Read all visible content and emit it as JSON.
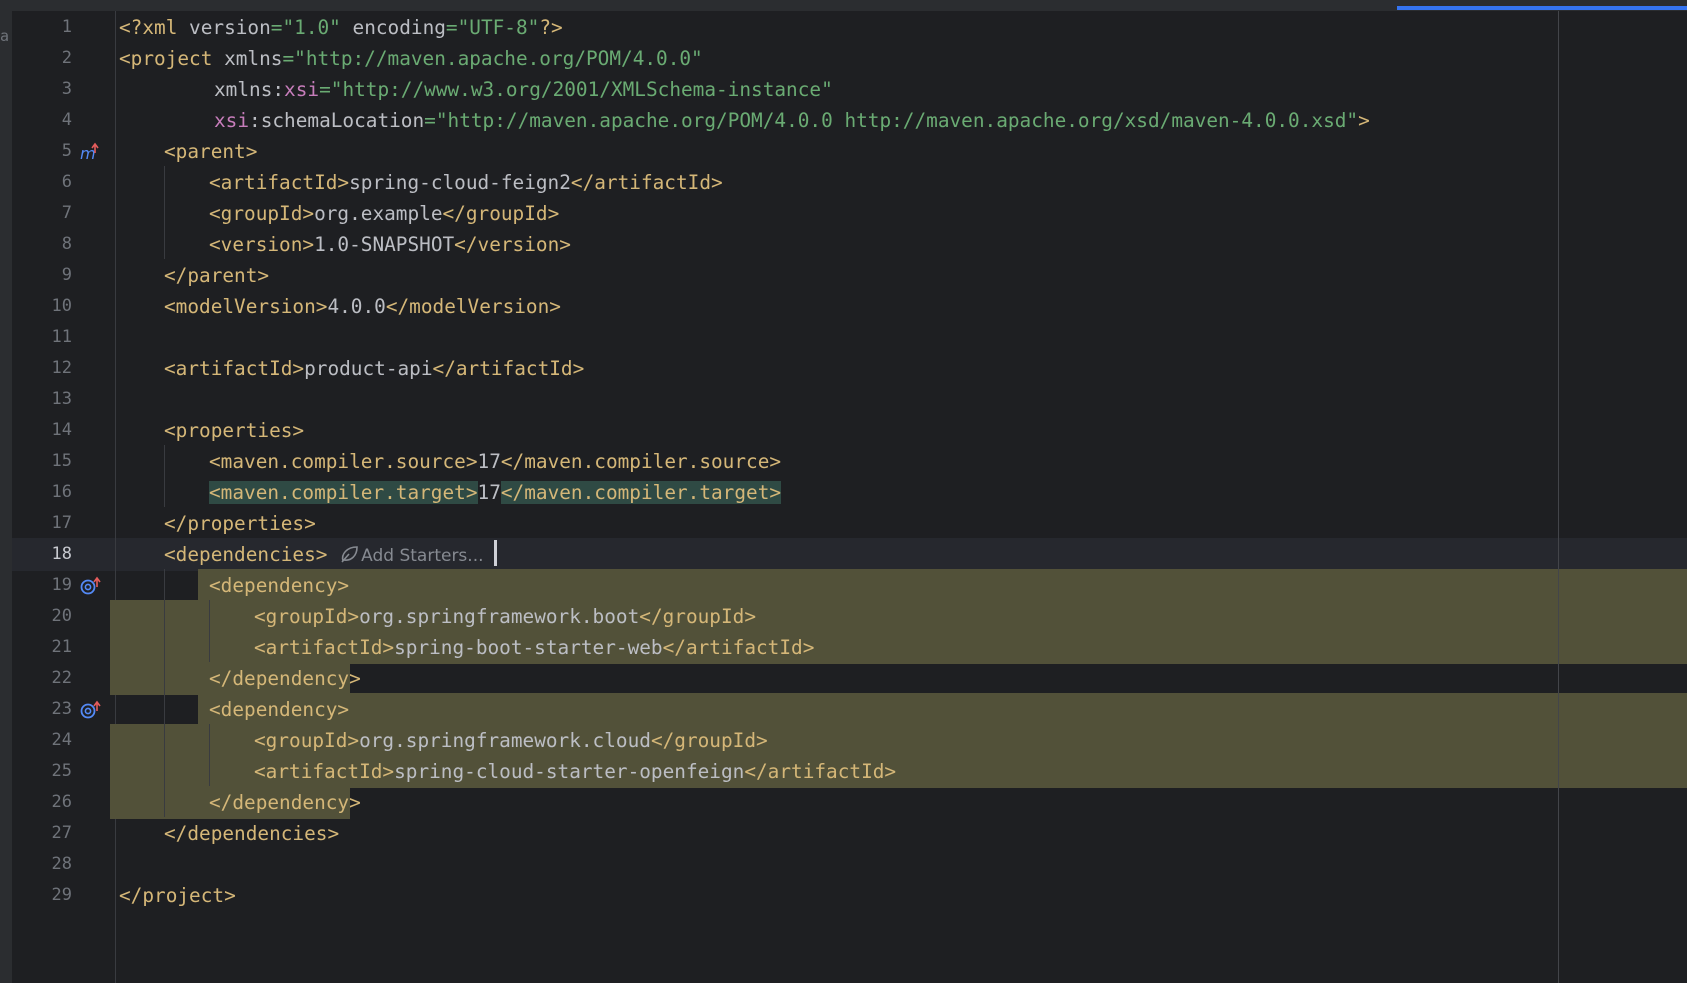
{
  "editor": {
    "left_strip_letter": "a",
    "current_line": 18,
    "lines": [
      {
        "n": "1"
      },
      {
        "n": "2"
      },
      {
        "n": "3"
      },
      {
        "n": "4"
      },
      {
        "n": "5"
      },
      {
        "n": "6"
      },
      {
        "n": "7"
      },
      {
        "n": "8"
      },
      {
        "n": "9"
      },
      {
        "n": "10"
      },
      {
        "n": "11"
      },
      {
        "n": "12"
      },
      {
        "n": "13"
      },
      {
        "n": "14"
      },
      {
        "n": "15"
      },
      {
        "n": "16"
      },
      {
        "n": "17"
      },
      {
        "n": "18"
      },
      {
        "n": "19"
      },
      {
        "n": "20"
      },
      {
        "n": "21"
      },
      {
        "n": "22"
      },
      {
        "n": "23"
      },
      {
        "n": "24"
      },
      {
        "n": "25"
      },
      {
        "n": "26"
      },
      {
        "n": "27"
      },
      {
        "n": "28"
      },
      {
        "n": "29"
      }
    ],
    "code": {
      "l1": {
        "open": "<?xml ",
        "a1": "version",
        "eq1": "=",
        "v1": "\"1.0\"",
        "a2": " encoding",
        "eq2": "=",
        "v2": "\"UTF-8\"",
        "close": "?>"
      },
      "l2": {
        "open": "<project ",
        "a1": "xmlns",
        "eq1": "=",
        "v1": "\"http://maven.apache.org/POM/4.0.0\""
      },
      "l3": {
        "a1": "xmlns:",
        "ns": "xsi",
        "eq1": "=",
        "v1": "\"http://www.w3.org/2001/XMLSchema-instance\""
      },
      "l4": {
        "ns": "xsi",
        "a1": ":schemaLocation",
        "eq1": "=",
        "v1": "\"http://maven.apache.org/POM/4.0.0 http://maven.apache.org/xsd/maven-4.0.0.xsd\"",
        "close": ">"
      },
      "l5": {
        "tag": "<parent>"
      },
      "l6": {
        "open": "<artifactId>",
        "text": "spring-cloud-feign2",
        "close": "</artifactId>"
      },
      "l7": {
        "open": "<groupId>",
        "text": "org.example",
        "close": "</groupId>"
      },
      "l8": {
        "open": "<version>",
        "text": "1.0-SNAPSHOT",
        "close": "</version>"
      },
      "l9": {
        "tag": "</parent>"
      },
      "l10": {
        "open": "<modelVersion>",
        "text": "4.0.0",
        "close": "</modelVersion>"
      },
      "l12": {
        "open": "<artifactId>",
        "text": "product-api",
        "close": "</artifactId>"
      },
      "l14": {
        "tag": "<properties>"
      },
      "l15": {
        "open": "<maven.compiler.source>",
        "text": "17",
        "close": "</maven.compiler.source>"
      },
      "l16": {
        "open": "<maven.compiler.target>",
        "text": "17",
        "close": "</maven.compiler.target>"
      },
      "l17": {
        "tag": "</properties>"
      },
      "l18": {
        "tag": "<dependencies>",
        "hint": "Add Starters..."
      },
      "l19": {
        "tag": "<dependency>"
      },
      "l20": {
        "open": "<groupId>",
        "text": "org.springframework.boot",
        "close": "</groupId>"
      },
      "l21": {
        "open": "<artifactId>",
        "text": "spring-boot-starter-web",
        "close": "</artifactId>"
      },
      "l22": {
        "tag": "</dependency>"
      },
      "l23": {
        "tag": "<dependency>"
      },
      "l24": {
        "open": "<groupId>",
        "text": "org.springframework.cloud",
        "close": "</groupId>"
      },
      "l25": {
        "open": "<artifactId>",
        "text": "spring-cloud-starter-openfeign",
        "close": "</artifactId>"
      },
      "l26": {
        "tag": "</dependency>"
      },
      "l27": {
        "tag": "</dependencies>"
      },
      "l29": {
        "tag": "</project>"
      }
    },
    "gutter_icons": {
      "l5": "maven-parent-icon",
      "l19": "dependency-goto-icon",
      "l23": "dependency-goto-icon"
    }
  }
}
